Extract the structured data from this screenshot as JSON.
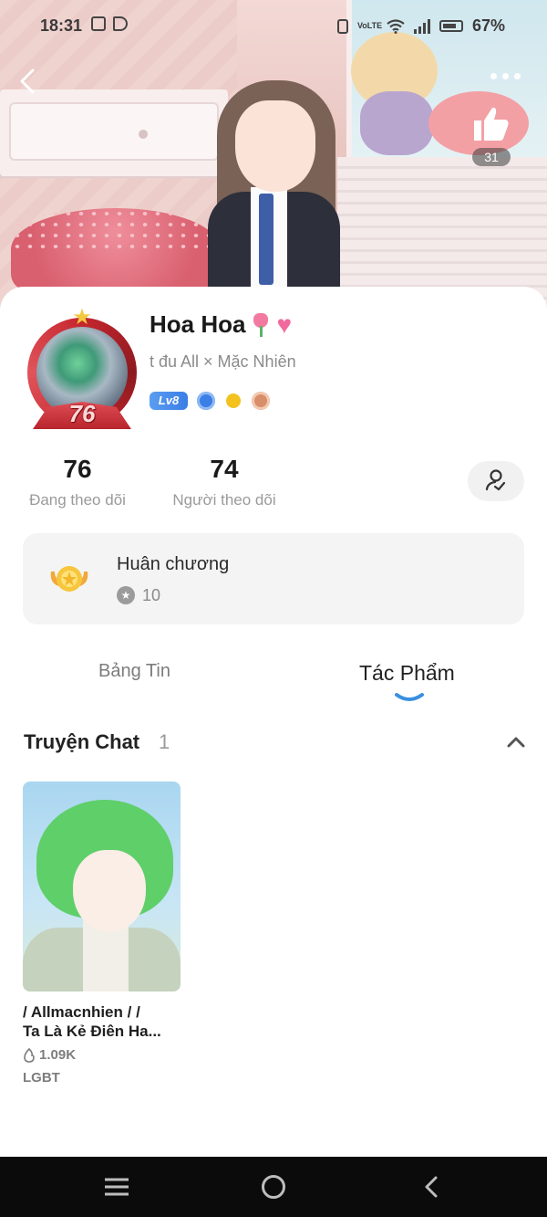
{
  "status_bar": {
    "time": "18:31",
    "network_label": "VoLTE",
    "battery": "67%"
  },
  "header": {
    "like_count": "31"
  },
  "profile": {
    "name": "Hoa Hoa",
    "bio": "t đu All × Mặc Nhiên",
    "avatar_level": "76",
    "level_badge": "Lv8",
    "badge_colors": [
      "#3a7ee6",
      "#f3c21f",
      "#d98e6a"
    ]
  },
  "stats": {
    "following_count": "76",
    "following_label": "Đang theo dõi",
    "followers_count": "74",
    "followers_label": "Người theo dõi"
  },
  "medals": {
    "title": "Huân chương",
    "count": "10"
  },
  "tabs": [
    {
      "label": "Bảng Tin",
      "active": false
    },
    {
      "label": "Tác Phẩm",
      "active": true
    }
  ],
  "section": {
    "title": "Truyện Chat",
    "count": "1"
  },
  "story": {
    "title_line1": "/ Allmacnhien / /",
    "title_line2": "Ta Là Kẻ Điên Ha...",
    "views": "1.09K",
    "tag": "LGBT"
  },
  "colors": {
    "accent": "#3a8fe0",
    "text_primary": "#1a1a1a",
    "text_secondary": "#9a9a9a"
  }
}
